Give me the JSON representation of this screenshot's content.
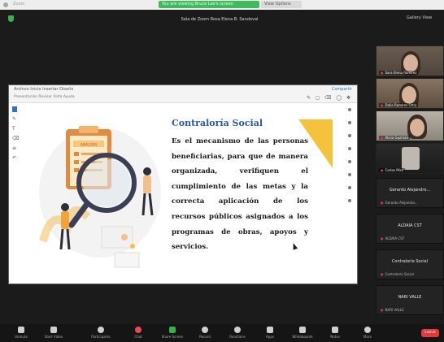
{
  "window": {
    "meeting_title": "Sala de Zoom Rosa Elena B. Sandoval",
    "share_banner": "You are viewing Bruce Lee's screen",
    "view_options": "View Options",
    "gallery_view": "Gallery View"
  },
  "ppt": {
    "toolbar_left": "Archivo   Inicio   Insertar   Diseño",
    "toolbar_sub": "Presentación   Revisar   Vista   Ayuda",
    "toolbar_right": "Compartir"
  },
  "slide": {
    "title": "Contraloría Social",
    "body": "Es el mecanismo de las personas beneficiarias, para que de manera organizada, verifiquen el cumplimiento de las metas y la correcta aplicación de los recursos públicos asignados a los programas de obras, apoyos y servicios.",
    "clipboard_label": "ANÁLISIS",
    "accent_color": "#f5c23b",
    "title_color": "#2b56a8"
  },
  "participants": {
    "video_tiles": [
      {
        "name": "Sara Elena Ramírez"
      },
      {
        "name": "Dalia Ramírez Ortiz"
      },
      {
        "name": "Alicia Guzmán"
      },
      {
        "name": "Carlos Mira"
      }
    ],
    "name_tiles": [
      {
        "title": "Gerardo Alejandro...",
        "sub": "Gerardo Alejandro..."
      },
      {
        "title": "ALDAIA CST",
        "sub": "ALDAIA CST"
      },
      {
        "title": "Contraloría Social",
        "sub": "Contraloría Social"
      },
      {
        "title": "NARI VALLE",
        "sub": "NARI VALLE"
      }
    ]
  },
  "toolbar": {
    "items": [
      "Unmute",
      "Start Video",
      "Participants",
      "Chat",
      "Share Screen",
      "Record",
      "Reactions",
      "Apps",
      "Whiteboards",
      "Notes",
      "More"
    ],
    "participants_count": "11",
    "end_label": "Leave"
  }
}
